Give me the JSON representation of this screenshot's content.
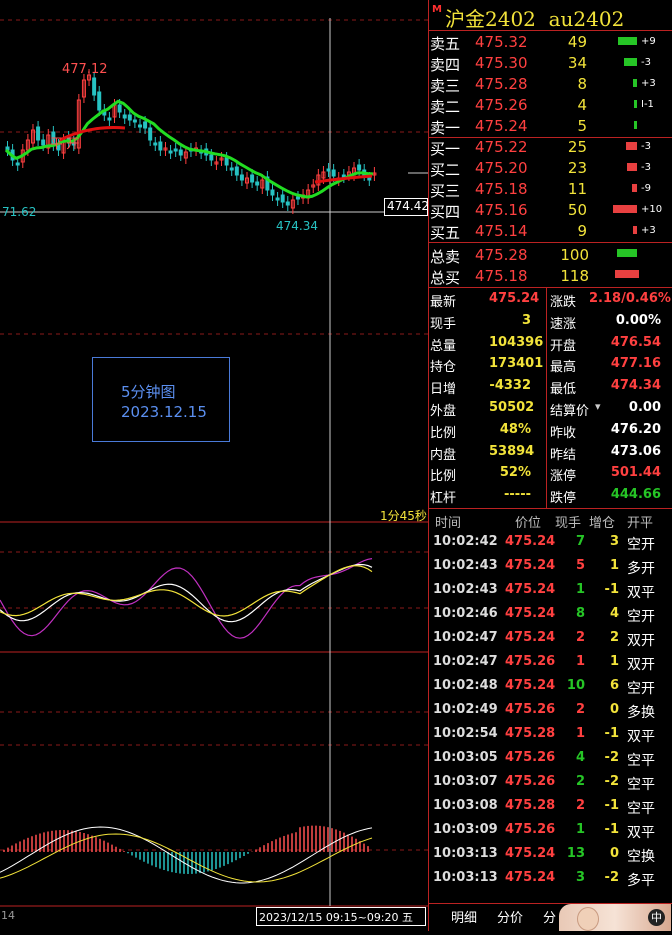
{
  "header": {
    "marker": "M",
    "title": "沪金2402  au2402"
  },
  "orderbook": {
    "asks": [
      {
        "label": "卖五",
        "price": "475.32",
        "vol": "49",
        "chg": "+9",
        "chg_color": "#26c526",
        "bar": 0.8
      },
      {
        "label": "卖四",
        "price": "475.30",
        "vol": "34",
        "chg": "-3",
        "chg_color": "#26c526",
        "bar": 0.55
      },
      {
        "label": "卖三",
        "price": "475.28",
        "vol": "8",
        "chg": "+3",
        "chg_color": "#26c526",
        "bar": 0.15
      },
      {
        "label": "卖二",
        "price": "475.26",
        "vol": "4",
        "chg": "I-1",
        "chg_color": "#26c526",
        "bar": 0.06
      },
      {
        "label": "卖一",
        "price": "475.24",
        "vol": "5",
        "chg": "",
        "chg_color": "#26c526",
        "bar": 0.08
      }
    ],
    "bids": [
      {
        "label": "买一",
        "price": "475.22",
        "vol": "25",
        "chg": "-3",
        "chg_color": "#e84040",
        "bar": 0.45
      },
      {
        "label": "买二",
        "price": "475.20",
        "vol": "23",
        "chg": "-3",
        "chg_color": "#e84040",
        "bar": 0.42
      },
      {
        "label": "买三",
        "price": "475.18",
        "vol": "11",
        "chg": "-9",
        "chg_color": "#e84040",
        "bar": 0.22
      },
      {
        "label": "买四",
        "price": "475.16",
        "vol": "50",
        "chg": "+10",
        "chg_color": "#e84040",
        "bar": 1.0
      },
      {
        "label": "买五",
        "price": "475.14",
        "vol": "9",
        "chg": "+3",
        "chg_color": "#e84040",
        "bar": 0.18
      }
    ],
    "total_sell": {
      "label": "总卖",
      "price": "475.28",
      "vol": "100"
    },
    "total_buy": {
      "label": "总买",
      "price": "475.18",
      "vol": "118"
    }
  },
  "stats": [
    {
      "l1": "最新",
      "v1": "475.24",
      "c1": "#ff4040",
      "l2": "涨跌",
      "v2": "2.18/0.46%",
      "c2": "#ff4040"
    },
    {
      "l1": "现手",
      "v1": "3",
      "c1": "#f2e33a",
      "l2": "速涨",
      "v2": "0.00%",
      "c2": "#fff"
    },
    {
      "l1": "总量",
      "v1": "104396",
      "c1": "#f2e33a",
      "l2": "开盘",
      "v2": "476.54",
      "c2": "#ff4040"
    },
    {
      "l1": "持仓",
      "v1": "173401",
      "c1": "#f2e33a",
      "l2": "最高",
      "v2": "477.16",
      "c2": "#ff4040"
    },
    {
      "l1": "日增",
      "v1": "-4332",
      "c1": "#f2e33a",
      "l2": "最低",
      "v2": "474.34",
      "c2": "#ff4040"
    },
    {
      "l1": "外盘",
      "v1": "50502",
      "c1": "#f2e33a",
      "l2": "结算价",
      "v2": "0.00",
      "c2": "#fff"
    },
    {
      "l1": "比例",
      "v1": "48%",
      "c1": "#f2e33a",
      "l2": "昨收",
      "v2": "476.20",
      "c2": "#fff"
    },
    {
      "l1": "内盘",
      "v1": "53894",
      "c1": "#f2e33a",
      "l2": "昨结",
      "v2": "473.06",
      "c2": "#fff"
    },
    {
      "l1": "比例",
      "v1": "52%",
      "c1": "#f2e33a",
      "l2": "涨停",
      "v2": "501.44",
      "c2": "#ff4040"
    },
    {
      "l1": "杠杆",
      "v1": "-----",
      "c1": "#f2e33a",
      "l2": "跌停",
      "v2": "444.66",
      "c2": "#26c526"
    }
  ],
  "ticks_header": {
    "time": "时间",
    "price": "价位",
    "vol": "现手",
    "oi": "增仓",
    "nature": "开平"
  },
  "ticks": [
    {
      "time": "10:02:42",
      "price": "475.24",
      "vol": "7",
      "vc": "#26c526",
      "oi": "3",
      "nature": "空开"
    },
    {
      "time": "10:02:43",
      "price": "475.24",
      "vol": "5",
      "vc": "#ff4040",
      "oi": "1",
      "nature": "多开"
    },
    {
      "time": "10:02:43",
      "price": "475.24",
      "vol": "1",
      "vc": "#26c526",
      "oi": "-1",
      "nature": "双平"
    },
    {
      "time": "10:02:46",
      "price": "475.24",
      "vol": "8",
      "vc": "#26c526",
      "oi": "4",
      "nature": "空开"
    },
    {
      "time": "10:02:47",
      "price": "475.24",
      "vol": "2",
      "vc": "#ff4040",
      "oi": "2",
      "nature": "双开"
    },
    {
      "time": "10:02:47",
      "price": "475.26",
      "vol": "1",
      "vc": "#ff4040",
      "oi": "1",
      "nature": "双开"
    },
    {
      "time": "10:02:48",
      "price": "475.24",
      "vol": "10",
      "vc": "#26c526",
      "oi": "6",
      "nature": "空开"
    },
    {
      "time": "10:02:49",
      "price": "475.26",
      "vol": "2",
      "vc": "#ff4040",
      "oi": "0",
      "nature": "多换"
    },
    {
      "time": "10:02:54",
      "price": "475.28",
      "vol": "1",
      "vc": "#ff4040",
      "oi": "-1",
      "nature": "双平"
    },
    {
      "time": "10:03:05",
      "price": "475.26",
      "vol": "4",
      "vc": "#26c526",
      "oi": "-2",
      "nature": "空平"
    },
    {
      "time": "10:03:07",
      "price": "475.26",
      "vol": "2",
      "vc": "#26c526",
      "oi": "-2",
      "nature": "空平"
    },
    {
      "time": "10:03:08",
      "price": "475.28",
      "vol": "2",
      "vc": "#ff4040",
      "oi": "-1",
      "nature": "空平"
    },
    {
      "time": "10:03:09",
      "price": "475.26",
      "vol": "1",
      "vc": "#26c526",
      "oi": "-1",
      "nature": "双平"
    },
    {
      "time": "10:03:13",
      "price": "475.24",
      "vol": "13",
      "vc": "#26c526",
      "oi": "0",
      "nature": "空换"
    },
    {
      "time": "10:03:13",
      "price": "475.24",
      "vol": "3",
      "vc": "#26c526",
      "oi": "-2",
      "nature": "多平"
    }
  ],
  "tabs": [
    "明细",
    "分价",
    "分"
  ],
  "chart": {
    "label_high": "477.12",
    "label_low_left": "71.62",
    "label_low": "474.34",
    "price_tag": "474.42",
    "info_title": "5分钟图",
    "info_date": "2023.12.15",
    "countdown": "1分45秒",
    "time_range": "2023/12/15 09:15~09:20 五",
    "corner_label": "14",
    "annotation_a": "平",
    "annotation_b": "开",
    "avatar_label": "中"
  }
}
